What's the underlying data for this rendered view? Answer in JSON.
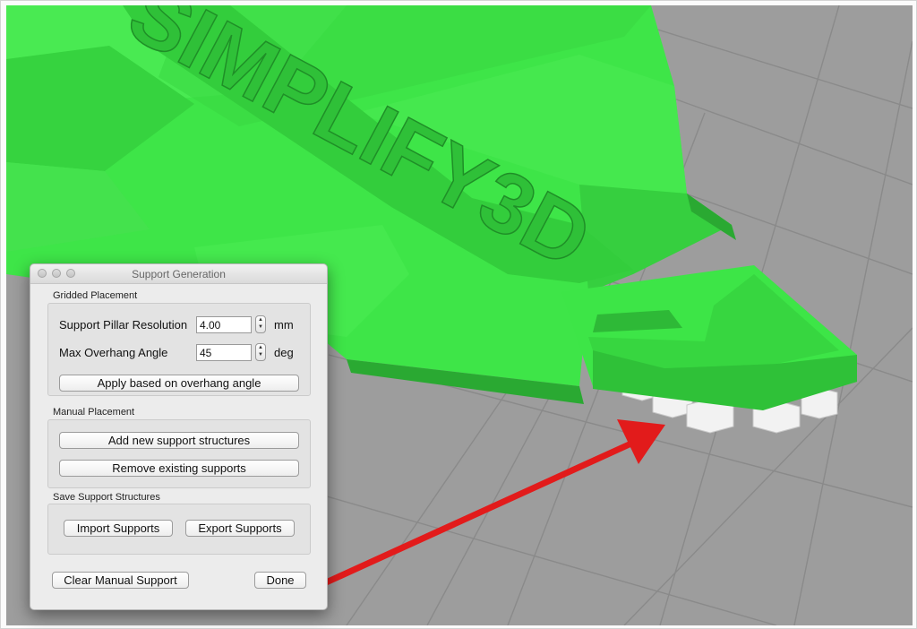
{
  "scene": {
    "model_label": "SIMPLIFY3D",
    "colors": {
      "model": "#3fe34a",
      "floor": "#9d9d9d",
      "grid": "#888888",
      "supports": "#f1f1f1",
      "arrow": "#e21b1b"
    }
  },
  "dialog": {
    "title": "Support Generation",
    "gridded": {
      "label": "Gridded Placement",
      "pillar_label": "Support Pillar Resolution",
      "pillar_value": "4.00",
      "pillar_unit": "mm",
      "angle_label": "Max Overhang Angle",
      "angle_value": "45",
      "angle_unit": "deg",
      "apply_button": "Apply based on overhang angle"
    },
    "manual": {
      "label": "Manual Placement",
      "add_button": "Add new support structures",
      "remove_button": "Remove existing supports"
    },
    "save": {
      "label": "Save Support Structures",
      "import_button": "Import Supports",
      "export_button": "Export Supports"
    },
    "clear_button": "Clear Manual Support",
    "done_button": "Done"
  }
}
